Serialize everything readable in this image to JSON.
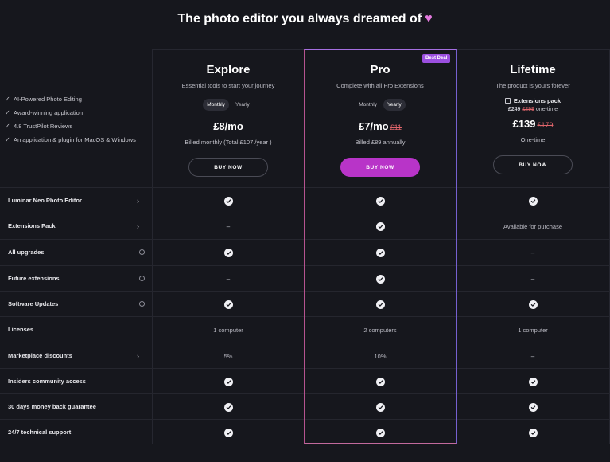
{
  "headline": "The photo editor you always dreamed of",
  "heart_icon": "♥",
  "features": [
    "AI-Powered Photo Editing",
    "Award-winning application",
    "4.8 TrustPilot Reviews",
    "An application & plugin for MacOS & Windows"
  ],
  "best_deal_badge": "Best Deal",
  "plans": {
    "explore": {
      "name": "Explore",
      "desc": "Essential tools to start your journey",
      "toggle": [
        "Monthly",
        "Yearly"
      ],
      "active_toggle": "Monthly",
      "price": "£8/mo",
      "billed": "Billed monthly (Total £107 /year )",
      "button": "BUY NOW"
    },
    "pro": {
      "name": "Pro",
      "desc": "Complete with all Pro Extensions",
      "toggle": [
        "Monthly",
        "Yearly"
      ],
      "active_toggle": "Yearly",
      "price": "£7/mo",
      "old_price": "£11",
      "billed": "Billed £89 annually",
      "button": "BUY NOW"
    },
    "lifetime": {
      "name": "Lifetime",
      "desc": "The product is yours forever",
      "extensions_label": "Extensions pack",
      "ext_price": "£249",
      "ext_old_price": "£299",
      "ext_suffix": "one-time",
      "price": "£139",
      "old_price": "£179",
      "billed": "One-time",
      "button": "BUY NOW"
    }
  },
  "rows": [
    {
      "label": "Luminar Neo Photo Editor",
      "marker": "chevron",
      "explore": "check",
      "pro": "check",
      "lifetime": "check"
    },
    {
      "label": "Extensions Pack",
      "marker": "chevron",
      "explore": "–",
      "pro": "check",
      "lifetime": "Available for purchase"
    },
    {
      "label": "All upgrades",
      "marker": "info",
      "explore": "check",
      "pro": "check",
      "lifetime": "–"
    },
    {
      "label": "Future extensions",
      "marker": "info",
      "explore": "–",
      "pro": "check",
      "lifetime": "–"
    },
    {
      "label": "Software Updates",
      "marker": "info",
      "explore": "check",
      "pro": "check",
      "lifetime": "check"
    },
    {
      "label": "Licenses",
      "marker": "",
      "explore": "1 computer",
      "pro": "2 computers",
      "lifetime": "1 computer"
    },
    {
      "label": "Marketplace discounts",
      "marker": "chevron",
      "explore": "5%",
      "pro": "10%",
      "lifetime": "–"
    },
    {
      "label": "Insiders community access",
      "marker": "",
      "explore": "check",
      "pro": "check",
      "lifetime": "check"
    },
    {
      "label": "30 days money back guarantee",
      "marker": "",
      "explore": "check",
      "pro": "check",
      "lifetime": "check"
    },
    {
      "label": "24/7 technical support",
      "marker": "",
      "explore": "check",
      "pro": "check",
      "lifetime": "check"
    }
  ],
  "chevron_glyph": "›",
  "info_glyph": "i",
  "colors": {
    "background": "#16171d",
    "accent": "#b834c8",
    "badge": "#9b4fe0",
    "strike": "#e0656b",
    "heart": "#e47adf"
  }
}
